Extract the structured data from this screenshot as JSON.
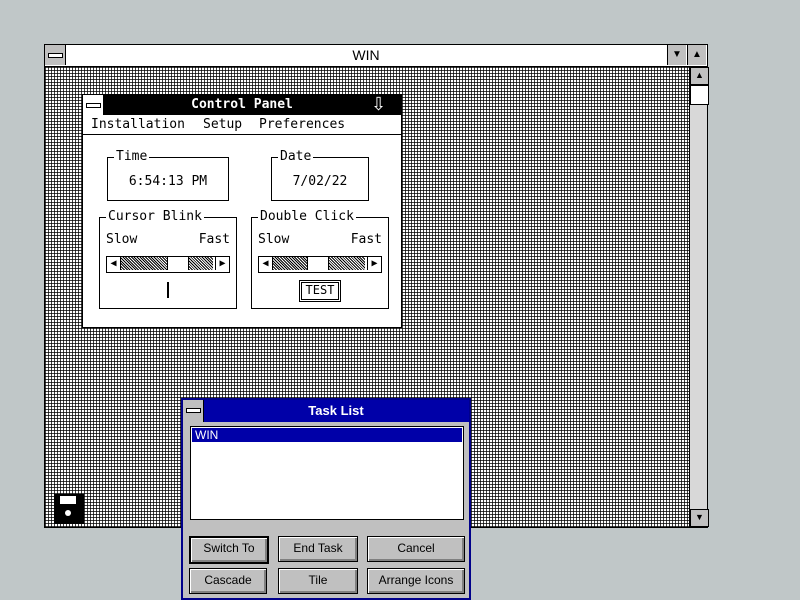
{
  "win_window": {
    "title": "WIN"
  },
  "control_panel": {
    "title": "Control Panel",
    "menu": [
      "Installation",
      "Setup",
      "Preferences"
    ],
    "time": {
      "label": "Time",
      "value": "6:54:13 PM"
    },
    "date": {
      "label": "Date",
      "value": "7/02/22"
    },
    "cursor_blink": {
      "label": "Cursor Blink",
      "slow": "Slow",
      "fast": "Fast"
    },
    "double_click": {
      "label": "Double Click",
      "slow": "Slow",
      "fast": "Fast",
      "test_button": "TEST"
    }
  },
  "task_list": {
    "title": "Task List",
    "items": [
      "WIN"
    ],
    "buttons": {
      "switch_to": "Switch To",
      "end_task": "End Task",
      "cancel": "Cancel",
      "cascade": "Cascade",
      "tile": "Tile",
      "arrange_icons": "Arrange Icons"
    }
  },
  "colors": {
    "desktop": "#c0c7c8",
    "active_title": "#0000a8",
    "cp_title": "#000000"
  }
}
